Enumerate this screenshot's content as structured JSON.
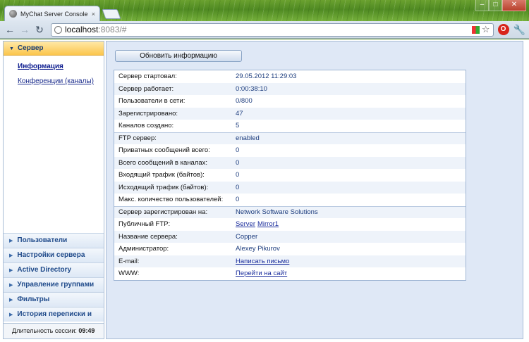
{
  "browser": {
    "tab_title": "MyChat Server Console",
    "tab_close": "×",
    "url_host": "localhost",
    "url_path": ":8083/#",
    "ext_label": "O"
  },
  "sidebar": {
    "active_section": "Сервер",
    "links": [
      {
        "label": "Информация",
        "active": true
      },
      {
        "label": "Конференции (каналы)",
        "active": false
      }
    ],
    "sections": [
      "Пользователи",
      "Настройки сервера",
      "Active Directory",
      "Управление группами",
      "Фильтры",
      "История переписки и логи"
    ],
    "session_label": "Длительность сессии:",
    "session_value": "09:49"
  },
  "main": {
    "refresh_label": "Обновить информацию",
    "rows": [
      {
        "key": "Сервер стартовал:",
        "value": "29.05.2012 11:29:03"
      },
      {
        "key": "Сервер работает:",
        "value": "0:00:38:10"
      },
      {
        "key": "Пользователи в сети:",
        "value": "0/800"
      },
      {
        "key": "Зарегистрировано:",
        "value": "47"
      },
      {
        "key": "Каналов создано:",
        "value": "5"
      },
      {
        "key": "FTP сервер:",
        "value": "enabled"
      },
      {
        "key": "Приватных сообщений всего:",
        "value": "0"
      },
      {
        "key": "Всего сообщений в каналах:",
        "value": "0"
      },
      {
        "key": "Входящий трафик (байтов):",
        "value": "0"
      },
      {
        "key": "Исходящий трафик (байтов):",
        "value": "0"
      },
      {
        "key": "Макс. количество пользователей:",
        "value": "0"
      },
      {
        "key": "Сервер зарегистрирован на:",
        "value": "Network Software Solutions"
      },
      {
        "key": "Публичный FTP:",
        "links": [
          "Server",
          "Mirror1"
        ]
      },
      {
        "key": "Название сервера:",
        "value": "Copper"
      },
      {
        "key": "Администратор:",
        "value": "Alexey Pikurov"
      },
      {
        "key": "E-mail:",
        "links": [
          "Написать письмо"
        ]
      },
      {
        "key": "WWW:",
        "links": [
          "Перейти на сайт"
        ]
      }
    ]
  }
}
